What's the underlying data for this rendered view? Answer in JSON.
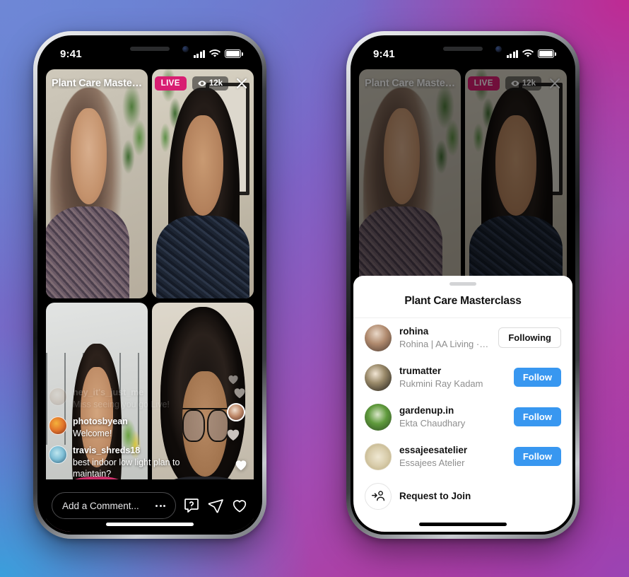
{
  "background": {
    "colors": [
      "#6b86d4",
      "#bf2a93",
      "#9a44b4",
      "#3a9fdc"
    ]
  },
  "accent": {
    "live": "#d81e72",
    "follow": "#3897f0",
    "muted": "#8e8e8e"
  },
  "status_bar": {
    "time": "9:41",
    "signal_icon": "cellular-bars-icon",
    "wifi_icon": "wifi-icon",
    "battery_icon": "battery-icon"
  },
  "live_header": {
    "title": "Plant Care Mastercla...",
    "live_label": "LIVE",
    "viewer_count": "12k",
    "viewer_icon": "eye-icon",
    "close_icon": "close-icon"
  },
  "comments": [
    {
      "username": "hey_it's_just_me",
      "text": "Miss seeing you go Live!",
      "avatar": "av-c",
      "state": "fading"
    },
    {
      "username": "photosbyean",
      "text": "Welcome!",
      "avatar": "av-a",
      "state": "visible"
    },
    {
      "username": "travis_shreds18",
      "text": "best indoor low light plan to maintain?",
      "avatar": "av-b",
      "state": "visible"
    }
  ],
  "bottom_bar": {
    "comment_placeholder": "Add a Comment...",
    "more_icon": "ellipsis-icon",
    "question_icon": "question-bubble-icon",
    "share_icon": "paper-plane-icon",
    "like_icon": "heart-icon"
  },
  "reactions": {
    "heart_icon": "floating-heart-icon",
    "avatar_bubble": "reaction-avatar-icon"
  },
  "sheet": {
    "title": "Plant Care Masterclass",
    "grabber": "sheet-grabber",
    "participants": [
      {
        "username": "rohina",
        "fullname": "Rohina | AA Living · Host",
        "action": "Following",
        "action_style": "following",
        "avatar": "pav1"
      },
      {
        "username": "trumatter",
        "fullname": "Rukmini Ray Kadam",
        "action": "Follow",
        "action_style": "follow",
        "avatar": "pav2"
      },
      {
        "username": "gardenup.in",
        "fullname": "Ekta Chaudhary",
        "action": "Follow",
        "action_style": "follow",
        "avatar": "pav3"
      },
      {
        "username": "essajeesatelier",
        "fullname": "Essajees Atelier",
        "action": "Follow",
        "action_style": "follow",
        "avatar": "pav4"
      }
    ],
    "join": {
      "label": "Request to Join",
      "icon": "person-arrow-icon"
    }
  }
}
